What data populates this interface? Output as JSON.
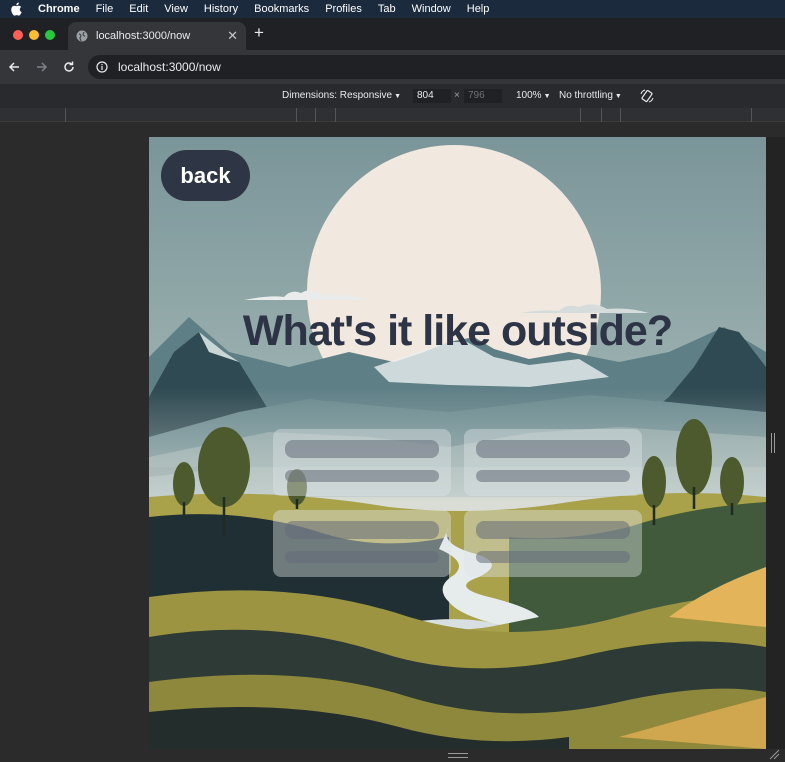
{
  "menubar": {
    "app": "Chrome",
    "items": [
      "File",
      "Edit",
      "View",
      "History",
      "Bookmarks",
      "Profiles",
      "Tab",
      "Window",
      "Help"
    ]
  },
  "tab": {
    "title": "localhost:3000/now"
  },
  "omnibox": {
    "url": "localhost:3000/now"
  },
  "devtools": {
    "dimensions_label": "Dimensions: Responsive",
    "width": "804",
    "height": "796",
    "times": "×",
    "zoom": "100%",
    "throttling": "No throttling"
  },
  "page": {
    "back_label": "back",
    "headline": "What's it like outside?"
  },
  "colors": {
    "sky": "#7e989c",
    "sun": "#f1e8df",
    "back_button": "#2e3544",
    "headline": "#2d3445"
  }
}
